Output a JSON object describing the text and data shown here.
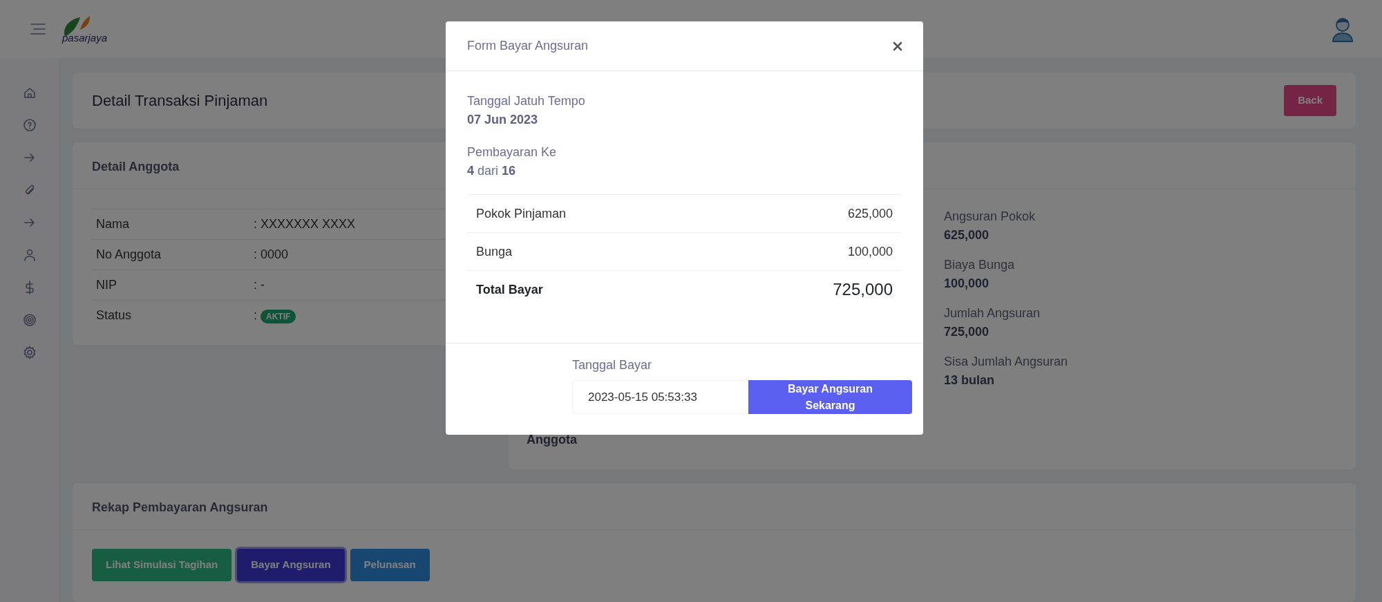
{
  "header": {
    "logo_text": "pasarjaya"
  },
  "page": {
    "title": "Detail Transaksi Pinjaman",
    "back_button": "Back"
  },
  "member_card": {
    "title": "Detail Anggota",
    "rows": [
      {
        "label": "Nama",
        "colon": ":",
        "value": "XXXXXXX XXXX",
        "kind": "text"
      },
      {
        "label": "No Anggota",
        "colon": ":",
        "value": "0000",
        "kind": "text"
      },
      {
        "label": "NIP",
        "colon": ":",
        "value": "-",
        "kind": "text"
      },
      {
        "label": "Status",
        "colon": ":",
        "value": "AKTIF",
        "kind": "badge"
      }
    ]
  },
  "loan_card": {
    "partial_label": "Anggota",
    "items": [
      {
        "label": "Angsuran Pokok",
        "value": "625,000"
      },
      {
        "label": "Biaya Bunga",
        "value": "100,000"
      },
      {
        "label": "Jumlah Angsuran",
        "value": "725,000"
      },
      {
        "label": "Sisa Jumlah Angsuran",
        "value": "13 bulan"
      }
    ]
  },
  "recap_card": {
    "title": "Rekap Pembayaran Angsuran",
    "buttons": [
      {
        "label": "Lihat Simulasi Tagihan",
        "kind": "success",
        "focused": false
      },
      {
        "label": "Bayar Angsuran",
        "kind": "primary",
        "focused": true
      },
      {
        "label": "Pelunasan",
        "kind": "info",
        "focused": false
      }
    ]
  },
  "modal": {
    "title": "Form Bayar Angsuran",
    "fields": [
      {
        "label": "Tanggal Jatuh Tempo",
        "value": "07 Jun 2023"
      },
      {
        "label": "Pembayaran Ke",
        "value": "**4** dari **16**"
      }
    ],
    "rows": [
      {
        "label": "Pokok Pinjaman",
        "value": "625,000",
        "kind": "item"
      },
      {
        "label": "Bunga",
        "value": "100,000",
        "kind": "item"
      },
      {
        "label": "Total Bayar",
        "value": "725,000",
        "kind": "total"
      }
    ],
    "date_label": "Tanggal Bayar",
    "date_value": "2023-05-15 05:53:33",
    "submit_button": "Bayar Angsuran Sekarang"
  }
}
